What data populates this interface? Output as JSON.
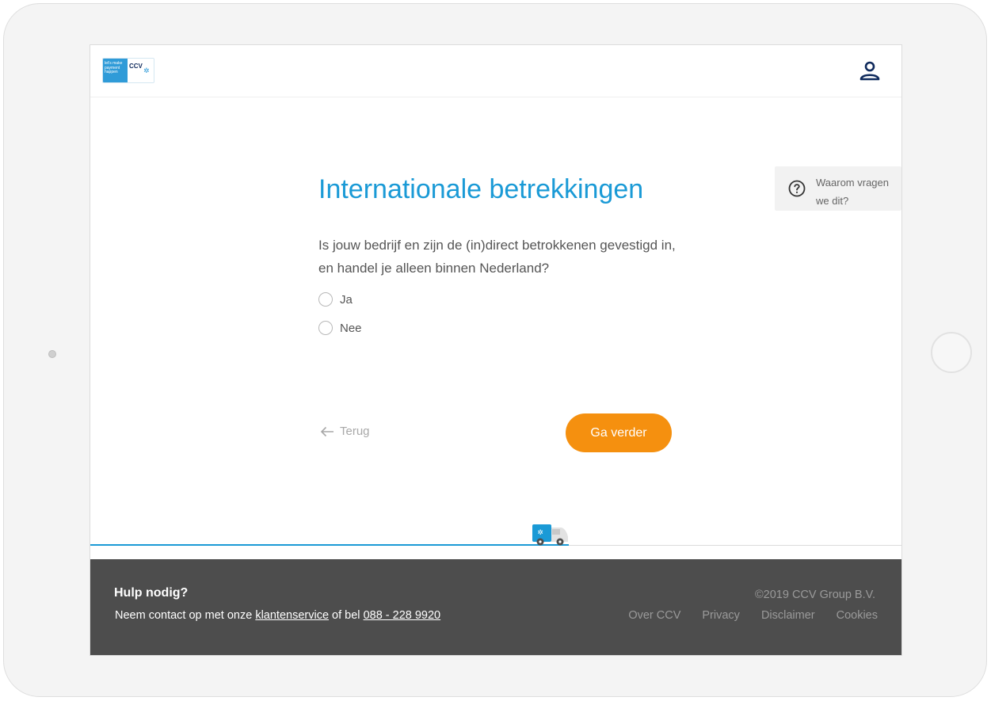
{
  "header": {
    "logo_tagline": "let's make payment happen",
    "logo_brand": "CCV",
    "user_icon": "user-icon"
  },
  "main": {
    "title": "Internationale betrekkingen",
    "question": "Is jouw bedrijf en zijn de (in)direct betrokkenen gevestigd in, en handel je alleen binnen Nederland?",
    "options": [
      {
        "label": "Ja",
        "selected": false
      },
      {
        "label": "Nee",
        "selected": false
      }
    ],
    "help": {
      "text": "Waarom vragen we dit?",
      "icon": "question-circle-icon"
    },
    "back_label": "Terug",
    "next_label": "Ga verder"
  },
  "progress": {
    "value_percent": 59,
    "icon": "truck-icon"
  },
  "footer": {
    "help_title": "Hulp nodig?",
    "contact_prefix": "Neem contact op met onze",
    "contact_link": "klantenservice",
    "contact_middle": "of bel",
    "phone": "088 - 228 9920",
    "copyright": "©2019 CCV Group B.V.",
    "links": [
      "Over CCV",
      "Privacy",
      "Disclaimer",
      "Cookies"
    ]
  },
  "colors": {
    "accent_blue": "#1a9ad6",
    "button_orange": "#f5900f",
    "footer_bg": "#4d4d4d"
  }
}
